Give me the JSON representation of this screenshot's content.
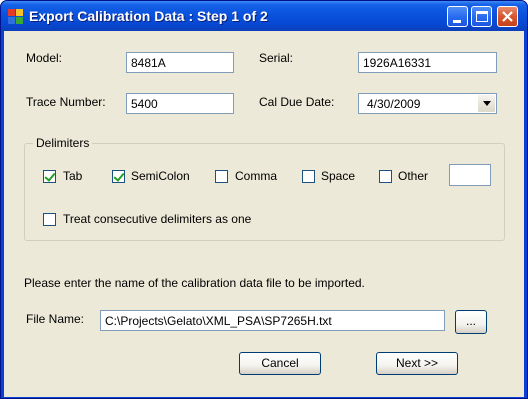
{
  "window": {
    "title": "Export Calibration Data : Step 1 of 2"
  },
  "fields": {
    "model_label": "Model:",
    "model_value": "8481A",
    "serial_label": "Serial:",
    "serial_value": "1926A16331",
    "trace_label": "Trace Number:",
    "trace_value": "5400",
    "caldue_label": "Cal Due Date:",
    "caldue_value": "4/30/2009"
  },
  "delimiters": {
    "legend": "Delimiters",
    "tab": {
      "label": "Tab",
      "checked": true
    },
    "semicolon": {
      "label": "SemiColon",
      "checked": true
    },
    "comma": {
      "label": "Comma",
      "checked": false
    },
    "space": {
      "label": "Space",
      "checked": false
    },
    "other": {
      "label": "Other",
      "checked": false,
      "value": ""
    },
    "consecutive": {
      "label": "Treat consecutive delimiters as one",
      "checked": false
    }
  },
  "instructions": "Please enter the name of the calibration data file to be imported.",
  "file": {
    "label": "File Name:",
    "value": "C:\\Projects\\Gelato\\XML_PSA\\SP7265H.txt",
    "browse_label": "..."
  },
  "buttons": {
    "cancel": "Cancel",
    "next": "Next >>"
  },
  "colors": {
    "titlebar": "#0a52dc",
    "client_bg": "#ece9d8",
    "checkmark": "#21a121",
    "close_button": "#d8562e"
  },
  "icons": [
    "app-icon",
    "minimize-icon",
    "maximize-icon",
    "close-icon",
    "chevron-down-icon"
  ]
}
